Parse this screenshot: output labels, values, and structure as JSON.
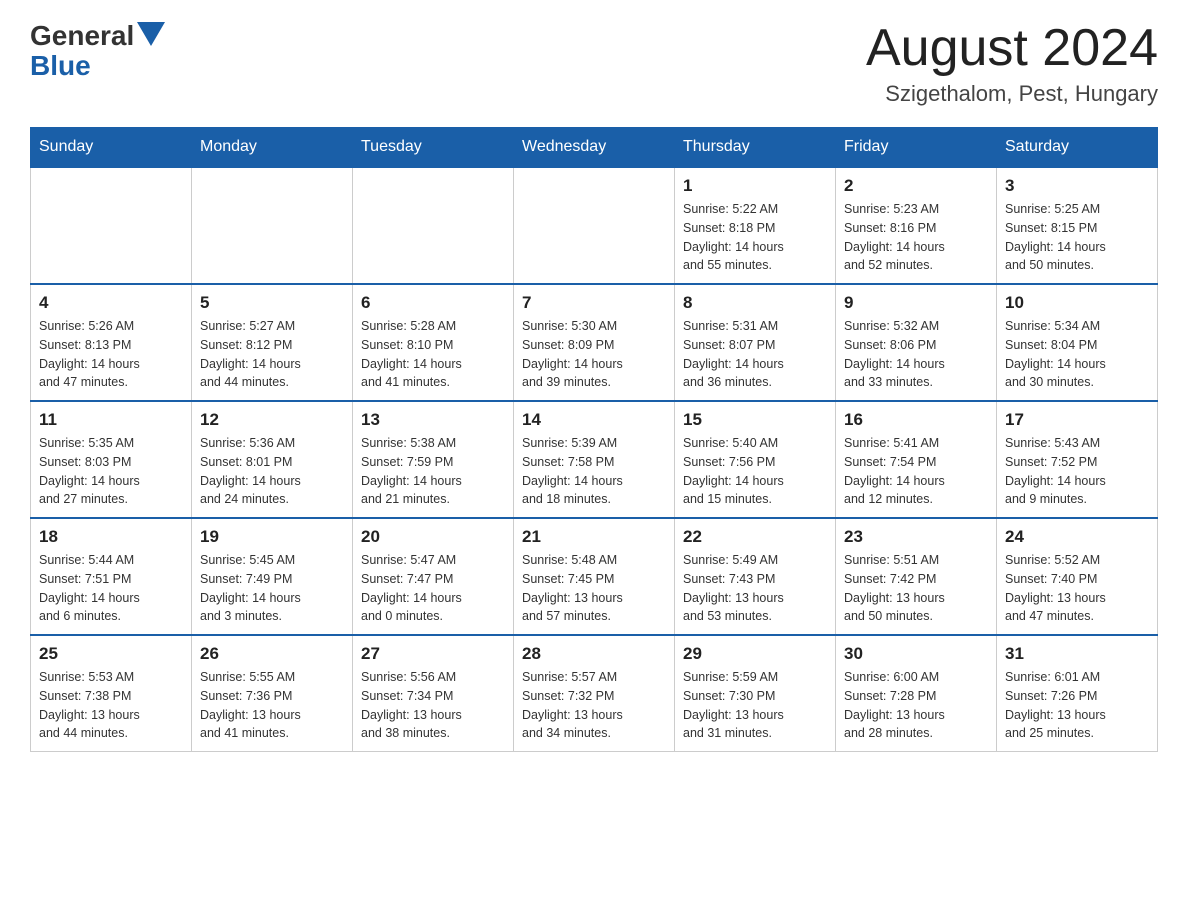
{
  "header": {
    "logo_general": "General",
    "logo_blue": "Blue",
    "title": "August 2024",
    "location": "Szigethalom, Pest, Hungary"
  },
  "days_of_week": [
    "Sunday",
    "Monday",
    "Tuesday",
    "Wednesday",
    "Thursday",
    "Friday",
    "Saturday"
  ],
  "weeks": [
    {
      "days": [
        {
          "number": "",
          "info": ""
        },
        {
          "number": "",
          "info": ""
        },
        {
          "number": "",
          "info": ""
        },
        {
          "number": "",
          "info": ""
        },
        {
          "number": "1",
          "info": "Sunrise: 5:22 AM\nSunset: 8:18 PM\nDaylight: 14 hours\nand 55 minutes."
        },
        {
          "number": "2",
          "info": "Sunrise: 5:23 AM\nSunset: 8:16 PM\nDaylight: 14 hours\nand 52 minutes."
        },
        {
          "number": "3",
          "info": "Sunrise: 5:25 AM\nSunset: 8:15 PM\nDaylight: 14 hours\nand 50 minutes."
        }
      ]
    },
    {
      "days": [
        {
          "number": "4",
          "info": "Sunrise: 5:26 AM\nSunset: 8:13 PM\nDaylight: 14 hours\nand 47 minutes."
        },
        {
          "number": "5",
          "info": "Sunrise: 5:27 AM\nSunset: 8:12 PM\nDaylight: 14 hours\nand 44 minutes."
        },
        {
          "number": "6",
          "info": "Sunrise: 5:28 AM\nSunset: 8:10 PM\nDaylight: 14 hours\nand 41 minutes."
        },
        {
          "number": "7",
          "info": "Sunrise: 5:30 AM\nSunset: 8:09 PM\nDaylight: 14 hours\nand 39 minutes."
        },
        {
          "number": "8",
          "info": "Sunrise: 5:31 AM\nSunset: 8:07 PM\nDaylight: 14 hours\nand 36 minutes."
        },
        {
          "number": "9",
          "info": "Sunrise: 5:32 AM\nSunset: 8:06 PM\nDaylight: 14 hours\nand 33 minutes."
        },
        {
          "number": "10",
          "info": "Sunrise: 5:34 AM\nSunset: 8:04 PM\nDaylight: 14 hours\nand 30 minutes."
        }
      ]
    },
    {
      "days": [
        {
          "number": "11",
          "info": "Sunrise: 5:35 AM\nSunset: 8:03 PM\nDaylight: 14 hours\nand 27 minutes."
        },
        {
          "number": "12",
          "info": "Sunrise: 5:36 AM\nSunset: 8:01 PM\nDaylight: 14 hours\nand 24 minutes."
        },
        {
          "number": "13",
          "info": "Sunrise: 5:38 AM\nSunset: 7:59 PM\nDaylight: 14 hours\nand 21 minutes."
        },
        {
          "number": "14",
          "info": "Sunrise: 5:39 AM\nSunset: 7:58 PM\nDaylight: 14 hours\nand 18 minutes."
        },
        {
          "number": "15",
          "info": "Sunrise: 5:40 AM\nSunset: 7:56 PM\nDaylight: 14 hours\nand 15 minutes."
        },
        {
          "number": "16",
          "info": "Sunrise: 5:41 AM\nSunset: 7:54 PM\nDaylight: 14 hours\nand 12 minutes."
        },
        {
          "number": "17",
          "info": "Sunrise: 5:43 AM\nSunset: 7:52 PM\nDaylight: 14 hours\nand 9 minutes."
        }
      ]
    },
    {
      "days": [
        {
          "number": "18",
          "info": "Sunrise: 5:44 AM\nSunset: 7:51 PM\nDaylight: 14 hours\nand 6 minutes."
        },
        {
          "number": "19",
          "info": "Sunrise: 5:45 AM\nSunset: 7:49 PM\nDaylight: 14 hours\nand 3 minutes."
        },
        {
          "number": "20",
          "info": "Sunrise: 5:47 AM\nSunset: 7:47 PM\nDaylight: 14 hours\nand 0 minutes."
        },
        {
          "number": "21",
          "info": "Sunrise: 5:48 AM\nSunset: 7:45 PM\nDaylight: 13 hours\nand 57 minutes."
        },
        {
          "number": "22",
          "info": "Sunrise: 5:49 AM\nSunset: 7:43 PM\nDaylight: 13 hours\nand 53 minutes."
        },
        {
          "number": "23",
          "info": "Sunrise: 5:51 AM\nSunset: 7:42 PM\nDaylight: 13 hours\nand 50 minutes."
        },
        {
          "number": "24",
          "info": "Sunrise: 5:52 AM\nSunset: 7:40 PM\nDaylight: 13 hours\nand 47 minutes."
        }
      ]
    },
    {
      "days": [
        {
          "number": "25",
          "info": "Sunrise: 5:53 AM\nSunset: 7:38 PM\nDaylight: 13 hours\nand 44 minutes."
        },
        {
          "number": "26",
          "info": "Sunrise: 5:55 AM\nSunset: 7:36 PM\nDaylight: 13 hours\nand 41 minutes."
        },
        {
          "number": "27",
          "info": "Sunrise: 5:56 AM\nSunset: 7:34 PM\nDaylight: 13 hours\nand 38 minutes."
        },
        {
          "number": "28",
          "info": "Sunrise: 5:57 AM\nSunset: 7:32 PM\nDaylight: 13 hours\nand 34 minutes."
        },
        {
          "number": "29",
          "info": "Sunrise: 5:59 AM\nSunset: 7:30 PM\nDaylight: 13 hours\nand 31 minutes."
        },
        {
          "number": "30",
          "info": "Sunrise: 6:00 AM\nSunset: 7:28 PM\nDaylight: 13 hours\nand 28 minutes."
        },
        {
          "number": "31",
          "info": "Sunrise: 6:01 AM\nSunset: 7:26 PM\nDaylight: 13 hours\nand 25 minutes."
        }
      ]
    }
  ]
}
